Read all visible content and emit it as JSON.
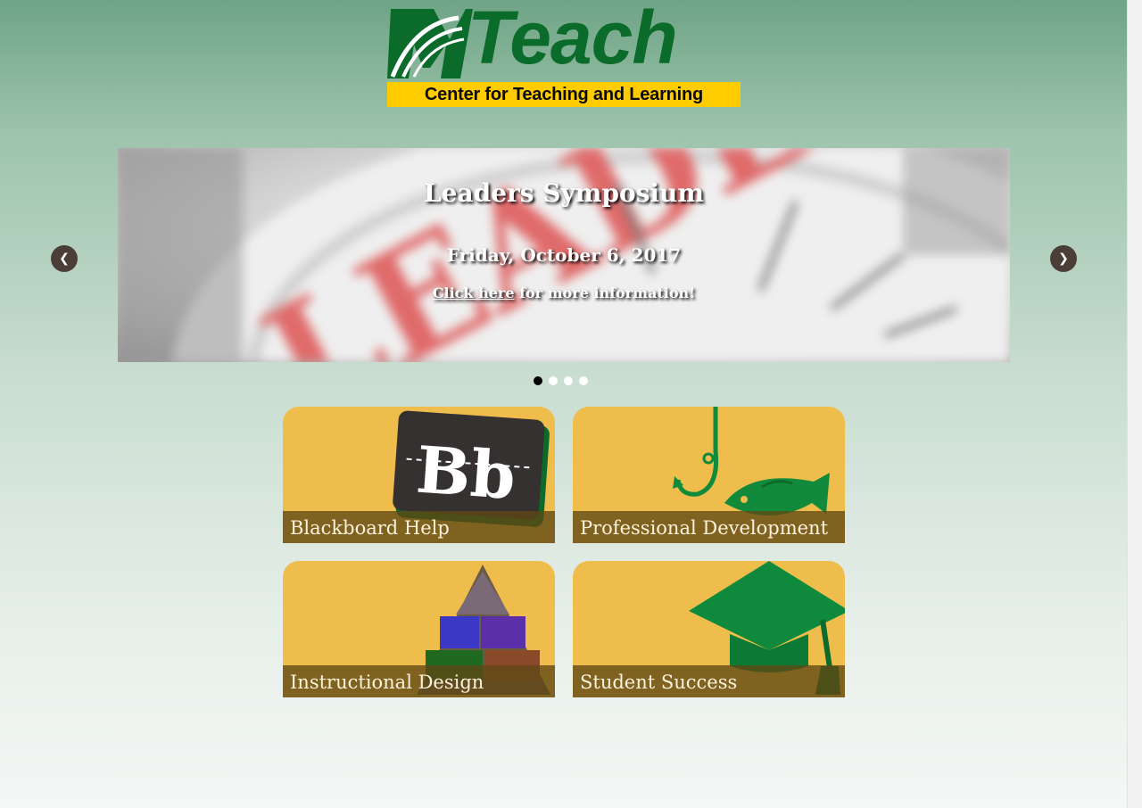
{
  "logo": {
    "wordmark": "Teach",
    "subtitle": "Center for Teaching and Learning"
  },
  "slider": {
    "title": "Leaders Symposium",
    "date": "Friday, October 6, 2017",
    "link_text": "Click here",
    "info_suffix": " for more information!",
    "prev_label": "❮",
    "next_label": "❯",
    "dots_count": 4,
    "active_dot": 1
  },
  "tiles": [
    {
      "label": "Blackboard Help",
      "icon": "blackboard-icon"
    },
    {
      "label": "Professional Development",
      "icon": "fishhook-icon"
    },
    {
      "label": "Instructional Design",
      "icon": "pyramid-icon"
    },
    {
      "label": "Student Success",
      "icon": "graduation-cap-icon"
    }
  ],
  "colors": {
    "brand_green": "#0b6b2a",
    "logo_yellow": "#ffcc00",
    "tile_gold": "#efbd4c",
    "arrow_bg": "#4a3e36"
  }
}
